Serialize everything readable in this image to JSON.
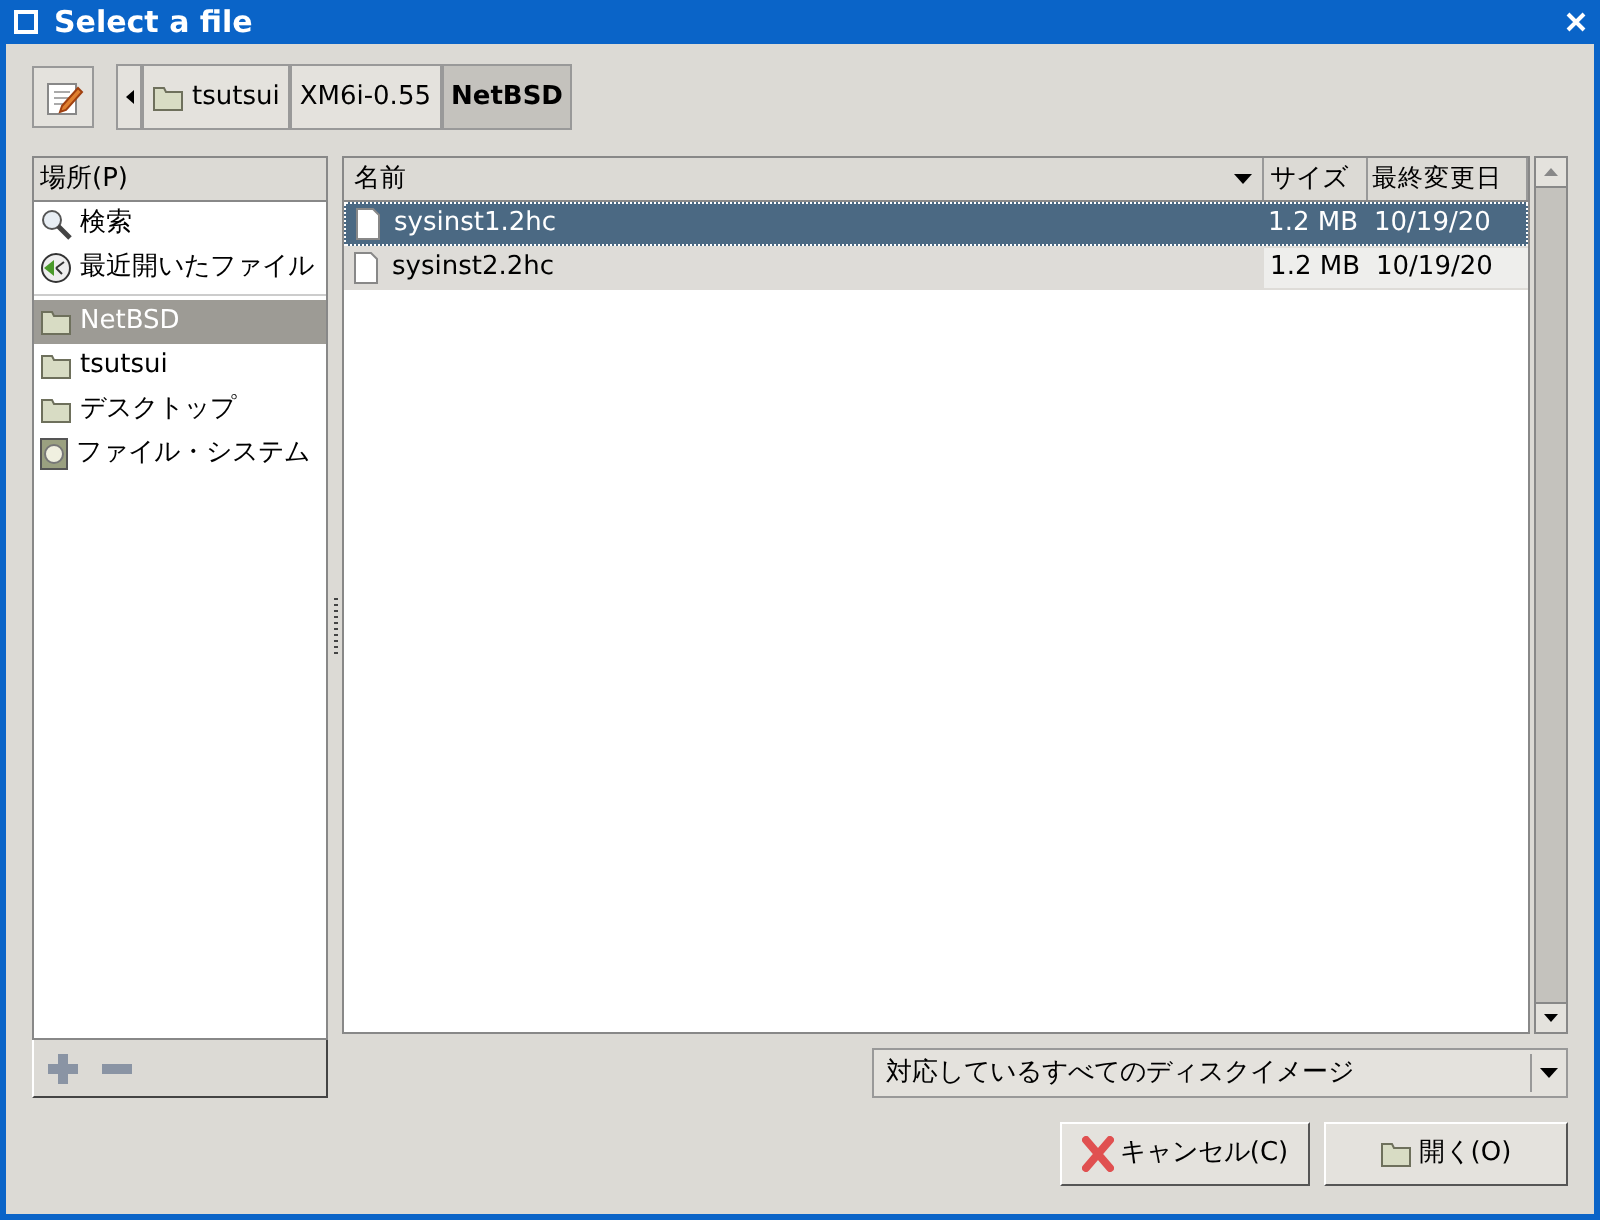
{
  "window": {
    "title": "Select a file"
  },
  "path_bar": {
    "segments": [
      {
        "label": "tsutsui",
        "kind": "folder",
        "selected": false
      },
      {
        "label": "XM6i-0.55",
        "kind": "plain",
        "selected": false
      },
      {
        "label": "NetBSD",
        "kind": "plain",
        "selected": true
      }
    ]
  },
  "places": {
    "header": "場所(P)",
    "sections": [
      [
        {
          "label": "検索",
          "kind": "search",
          "selected": false
        },
        {
          "label": "最近開いたファイル",
          "kind": "recent",
          "selected": false
        }
      ],
      [
        {
          "label": "NetBSD",
          "kind": "folder",
          "selected": true
        },
        {
          "label": "tsutsui",
          "kind": "folder",
          "selected": false
        },
        {
          "label": "デスクトップ",
          "kind": "folder",
          "selected": false
        },
        {
          "label": "ファイル・システム",
          "kind": "drive",
          "selected": false
        }
      ]
    ]
  },
  "files": {
    "columns": [
      "名前",
      "サイズ",
      "最終変更日"
    ],
    "rows": [
      {
        "name": "sysinst1.2hc",
        "size": "1.2 MB",
        "modified": "10/19/20",
        "selected": true
      },
      {
        "name": "sysinst2.2hc",
        "size": "1.2 MB",
        "modified": "10/19/20",
        "selected": false
      }
    ]
  },
  "filter": {
    "value": "対応しているすべてのディスクイメージ"
  },
  "buttons": [
    {
      "label": "キャンセル(C)",
      "kind": "cancel"
    },
    {
      "label": "開く(O)",
      "kind": "open"
    }
  ]
}
